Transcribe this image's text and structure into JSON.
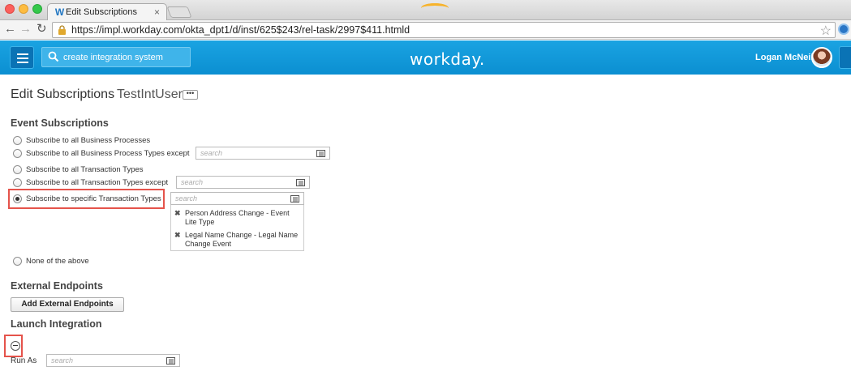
{
  "browser": {
    "tab_title": "Edit Subscriptions",
    "favicon": "W",
    "tab_close": "×",
    "url": "https://impl.workday.com/okta_dpt1/d/inst/625$243/rel-task/2997$411.htmld",
    "back_icon": "←",
    "forward_icon": "→",
    "reload_icon": "↻",
    "star_icon": "☆"
  },
  "header": {
    "search_text": "create integration system",
    "logo_text": "workday.",
    "user_name": "Logan McNeil",
    "brand_color": "#0b8fd1",
    "accent_color": "#f7b32b"
  },
  "page": {
    "title": "Edit Subscriptions",
    "subtitle": "TestIntUser",
    "related_icon": "•••"
  },
  "event_subscriptions": {
    "heading": "Event Subscriptions",
    "options": [
      {
        "label": "Subscribe to all Business Processes",
        "checked": false
      },
      {
        "label": "Subscribe to all Business Process Types except",
        "checked": false,
        "placeholder": "search"
      },
      {
        "label": "Subscribe to all Transaction Types",
        "checked": false
      },
      {
        "label": "Subscribe to all Transaction Types except",
        "checked": false,
        "placeholder": "search"
      },
      {
        "label": "Subscribe to specific Transaction Types",
        "checked": true,
        "placeholder": "search"
      },
      {
        "label": "None of the above",
        "checked": false
      }
    ],
    "selected_types": [
      "Person Address Change - Event Lite Type",
      "Legal Name Change - Legal Name Change Event"
    ],
    "remove_glyph": "✖"
  },
  "external_endpoints": {
    "heading": "External Endpoints",
    "button_label": "Add External Endpoints"
  },
  "launch_integration": {
    "heading": "Launch Integration",
    "run_as_label": "Run As",
    "run_as_placeholder": "search"
  },
  "highlight_color": "#e5534b"
}
